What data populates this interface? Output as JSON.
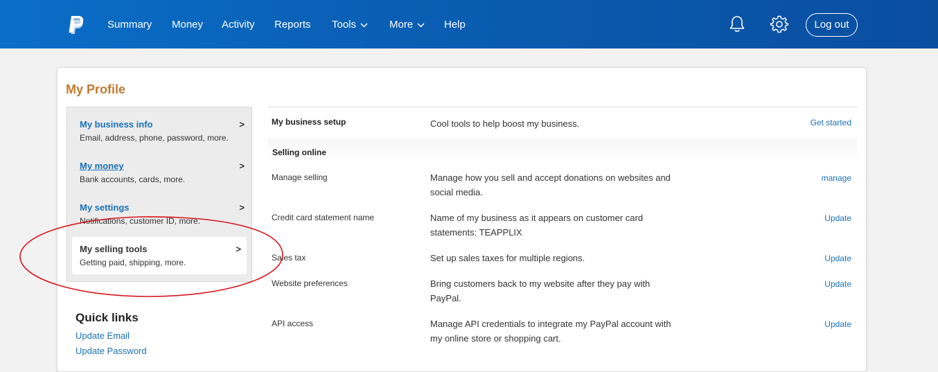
{
  "nav": {
    "items": [
      "Summary",
      "Money",
      "Activity",
      "Reports",
      "Tools",
      "More",
      "Help"
    ],
    "logout": "Log out"
  },
  "page": {
    "title": "My Profile"
  },
  "sidebar": {
    "items": [
      {
        "title": "My business info",
        "sub": "Email, address, phone, password, more."
      },
      {
        "title": "My money",
        "sub": "Bank accounts, cards, more."
      },
      {
        "title": "My settings",
        "sub": "Notifications, customer ID, more."
      },
      {
        "title": "My selling tools",
        "sub": "Getting paid, shipping, more."
      }
    ],
    "arrow": ">"
  },
  "quicklinks": {
    "title": "Quick links",
    "links": [
      "Update Email",
      "Update Password"
    ]
  },
  "content": {
    "business_setup": {
      "label": "My business setup",
      "desc": "Cool tools to help boost my business.",
      "action": "Get started"
    },
    "section": "Selling online",
    "rows": [
      {
        "label": "Manage selling",
        "desc": "Manage how you sell and accept donations on websites and social media.",
        "action": "manage"
      },
      {
        "label": "Credit card statement name",
        "desc": "Name of my business as it appears on customer card statements: TEAPPLIX",
        "action": "Update"
      },
      {
        "label": "Sales tax",
        "desc": "Set up sales taxes for multiple regions.",
        "action": "Update"
      },
      {
        "label": "Website preferences",
        "desc": "Bring customers back to my website after they pay with PayPal.",
        "action": "Update"
      },
      {
        "label": "API access",
        "desc": "Manage API credentials to integrate my PayPal account with my online store or shopping cart.",
        "action": "Update"
      }
    ]
  },
  "colors": {
    "nav_bg": "#0a5fb4",
    "title_orange": "#c07a2e",
    "link_blue": "#1a70b8",
    "annotation_red": "#d9141c"
  }
}
